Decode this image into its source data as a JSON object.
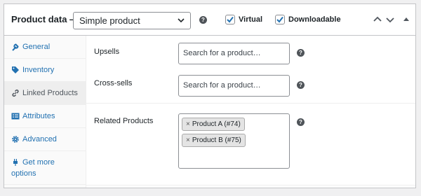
{
  "header": {
    "title": "Product data —",
    "product_type": "Simple product",
    "virtual_label": "Virtual",
    "virtual_checked": true,
    "downloadable_label": "Downloadable",
    "downloadable_checked": true,
    "help_glyph": "?"
  },
  "sidebar": {
    "items": [
      {
        "label": "General",
        "icon": "wrench-icon"
      },
      {
        "label": "Inventory",
        "icon": "tag-icon"
      },
      {
        "label": "Linked Products",
        "icon": "link-icon",
        "active": true
      },
      {
        "label": "Attributes",
        "icon": "list-icon"
      },
      {
        "label": "Advanced",
        "icon": "gear-icon"
      },
      {
        "label": "Get more",
        "label_line2": "options",
        "icon": "plugin-icon"
      }
    ]
  },
  "linked": {
    "upsells_label": "Upsells",
    "upsells_placeholder": "Search for a product…",
    "crosssells_label": "Cross-sells",
    "crosssells_placeholder": "Search for a product…",
    "related_label": "Related Products",
    "related_items": [
      {
        "remove": "×",
        "label": "Product A (#74)"
      },
      {
        "remove": "×",
        "label": "Product B (#75)"
      }
    ]
  },
  "colors": {
    "link": "#2271b1",
    "checkbox_accent": "#2271b1",
    "help_icon": "#4f5459"
  }
}
